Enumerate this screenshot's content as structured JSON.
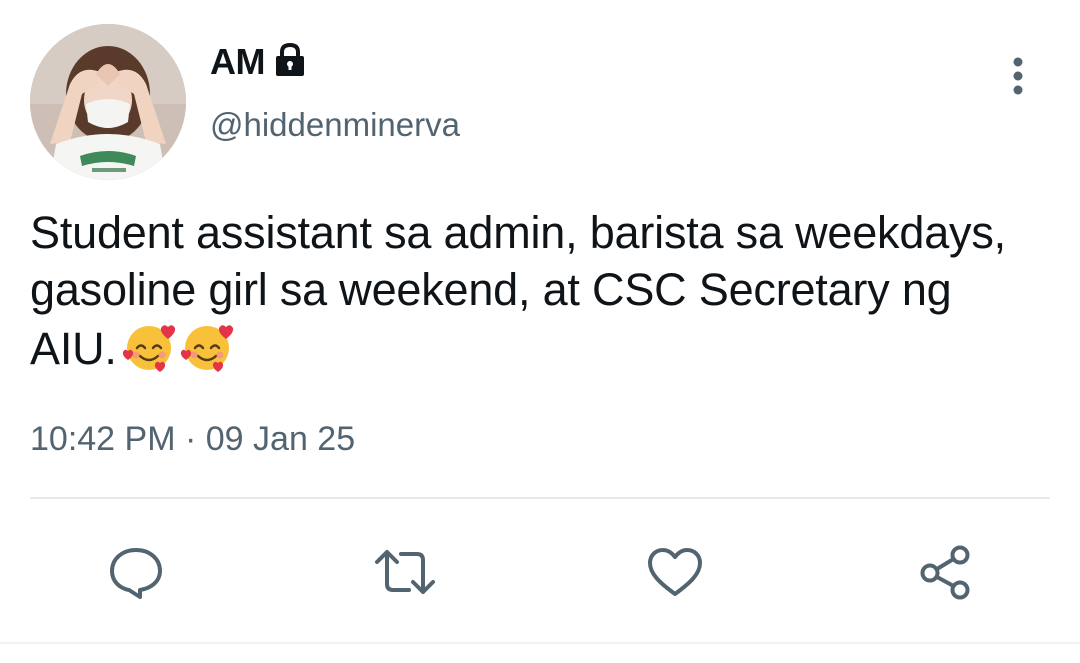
{
  "user": {
    "display_name": "AM",
    "handle": "@hiddenminerva",
    "protected_icon": "lock-icon",
    "avatar_icon": "profile-photo"
  },
  "tweet": {
    "text": "Student assistant sa admin, barista sa weekdays, gasoline girl sa weekend, at CSC Secretary ng AIU.",
    "emojis": [
      "smiling-face-with-hearts",
      "smiling-face-with-hearts"
    ],
    "time": "10:42 PM",
    "separator": "·",
    "date": "09 Jan 25"
  },
  "actions": {
    "reply_icon": "reply-icon",
    "retweet_icon": "retweet-icon",
    "like_icon": "heart-icon",
    "share_icon": "share-icon",
    "more_icon": "more-vertical-icon"
  },
  "colors": {
    "text": "#0f1419",
    "secondary": "#536471",
    "divider": "#e6e9eb"
  }
}
